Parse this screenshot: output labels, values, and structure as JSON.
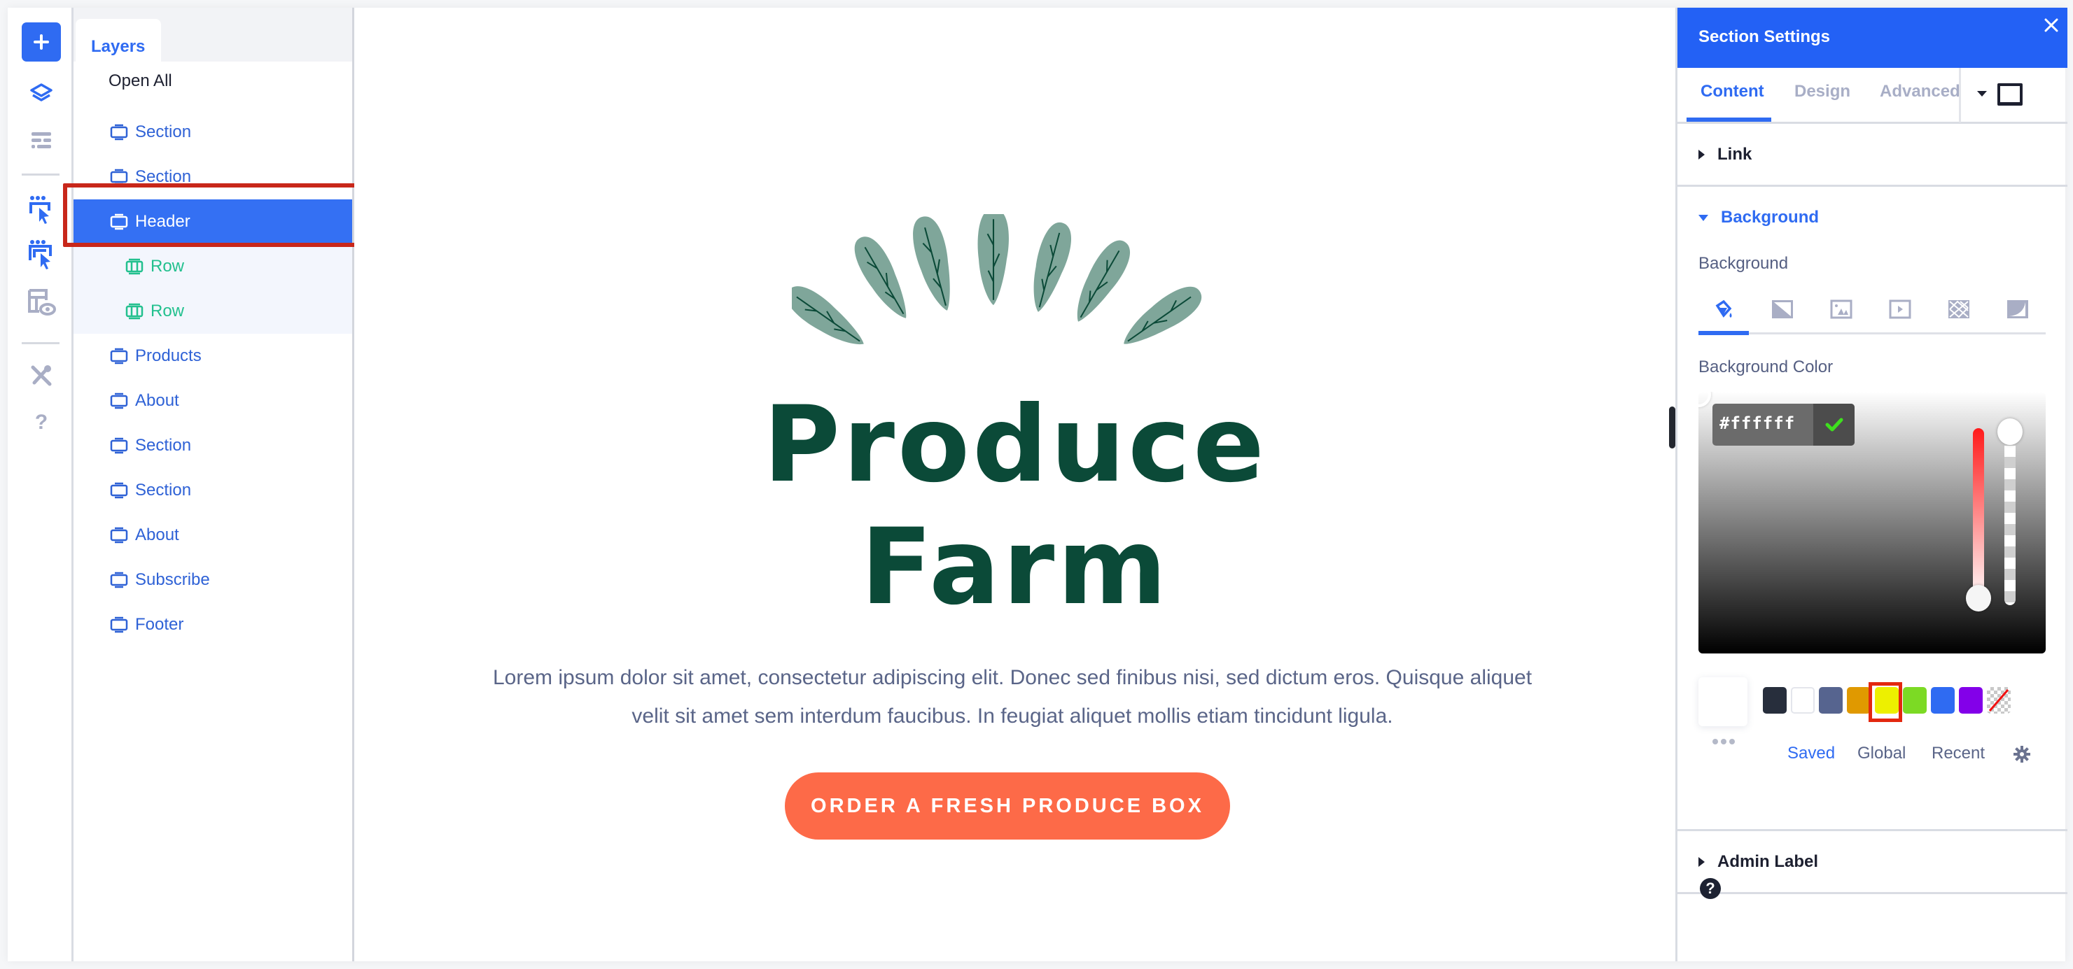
{
  "rail": {
    "items": [
      {
        "name": "add",
        "icon": "plus-icon"
      },
      {
        "name": "layers",
        "icon": "layers-icon"
      },
      {
        "name": "page-settings",
        "icon": "layout-list-icon"
      },
      {
        "name": "select-module",
        "icon": "cursor-select-icon"
      },
      {
        "name": "select-multi",
        "icon": "cursor-multi-select-icon"
      },
      {
        "name": "preview",
        "icon": "layout-preview-icon"
      },
      {
        "name": "tools",
        "icon": "tools-icon"
      },
      {
        "name": "help",
        "icon": "question-icon",
        "label": "?"
      }
    ]
  },
  "layers": {
    "tab_label": "Layers",
    "open_all": "Open All",
    "items": [
      {
        "label": "Section",
        "type": "section",
        "selected": false
      },
      {
        "label": "Section",
        "type": "section",
        "selected": false
      },
      {
        "label": "Header",
        "type": "section",
        "selected": true
      },
      {
        "label": "Row",
        "type": "row",
        "selected": false
      },
      {
        "label": "Row",
        "type": "row",
        "selected": false
      },
      {
        "label": "Products",
        "type": "section",
        "selected": false
      },
      {
        "label": "About",
        "type": "section",
        "selected": false
      },
      {
        "label": "Section",
        "type": "section",
        "selected": false
      },
      {
        "label": "Section",
        "type": "section",
        "selected": false
      },
      {
        "label": "About",
        "type": "section",
        "selected": false
      },
      {
        "label": "Subscribe",
        "type": "section",
        "selected": false
      },
      {
        "label": "Footer",
        "type": "section",
        "selected": false
      }
    ]
  },
  "canvas": {
    "title_line1": "Produce",
    "title_line2": "Farm",
    "body": "Lorem ipsum dolor sit amet, consectetur adipiscing elit. Donec sed finibus nisi, sed dictum eros. Quisque aliquet velit sit amet sem interdum faucibus. In feugiat aliquet mollis etiam tincidunt ligula.",
    "cta": "ORDER A FRESH PRODUCE BOX",
    "colors": {
      "title": "#0b4a38",
      "leaf": "#7fa69a",
      "cta": "#fd6a48"
    }
  },
  "settings": {
    "title": "Section Settings",
    "close": "×",
    "tabs": [
      {
        "label": "Content",
        "active": true
      },
      {
        "label": "Design",
        "active": false
      },
      {
        "label": "Advanced",
        "active": false
      }
    ],
    "link": "Link",
    "background_section": "Background",
    "background_label": "Background",
    "bg_types": [
      "color-fill-icon",
      "gradient-icon",
      "image-icon",
      "video-icon",
      "pattern-icon",
      "mask-icon"
    ],
    "bg_color_label": "Background Color",
    "hex_value": "#ffffff",
    "swatches": [
      "#272e3c",
      "#ffffff",
      "#56648f",
      "#e09900",
      "#edf000",
      "#7cda24",
      "#2f6bf2",
      "#8300e9",
      "transparent"
    ],
    "selected_swatch_index": 4,
    "palette_tabs": [
      {
        "label": "Saved",
        "active": true
      },
      {
        "label": "Global",
        "active": false
      },
      {
        "label": "Recent",
        "active": false
      }
    ],
    "admin_label": "Admin Label",
    "help": "?"
  }
}
